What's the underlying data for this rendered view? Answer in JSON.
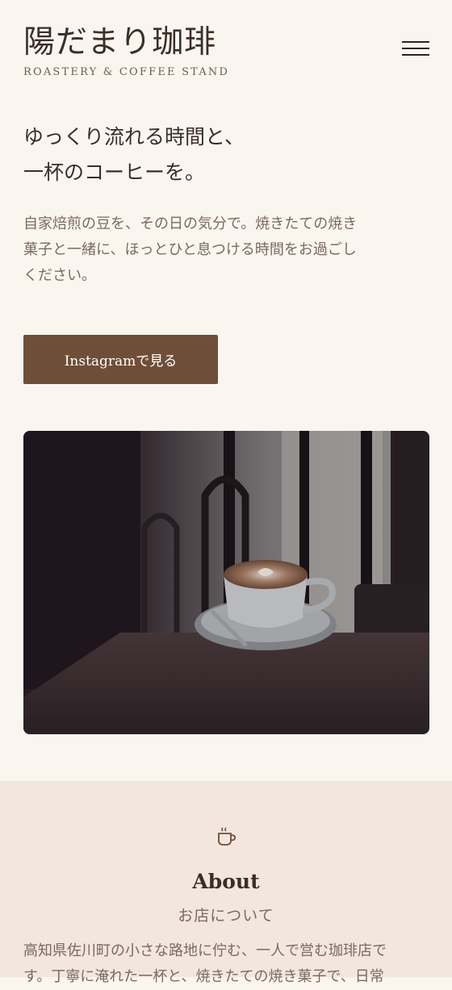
{
  "header": {
    "logo_title": "陽だまり珈琲",
    "logo_subtitle": "ROASTERY & COFFEE STAND",
    "menu_icon": "hamburger-menu-icon"
  },
  "hero": {
    "heading_lines": [
      "ゆっくり流れる時間と、",
      "一杯のコーヒーを。"
    ],
    "text_lines": [
      "自家焙煎の豆を、その日の気分で。焼きたての焼き",
      "菓子と一緒に、ほっとひと息つける時間をお過ごし",
      "ください。"
    ],
    "cta_label": "Instagramで見る"
  },
  "photo": {
    "subject": "latte-art-cup-on-wooden-table"
  },
  "about": {
    "icon": "coffee-cup-icon",
    "title": "About",
    "subtitle": "お店について",
    "text_lines": [
      "高知県佐川町の小さな路地に佇む、一人で営む珈琲店で",
      "す。丁寧に淹れた一杯と、焼きたての焼き菓子で、日常"
    ]
  },
  "colors": {
    "background": "#fbf5f0",
    "accent_button": "#6f4e37",
    "section_background": "#f3e6dd",
    "text_dark": "#3a2e28",
    "text_muted": "#7a6a60"
  }
}
